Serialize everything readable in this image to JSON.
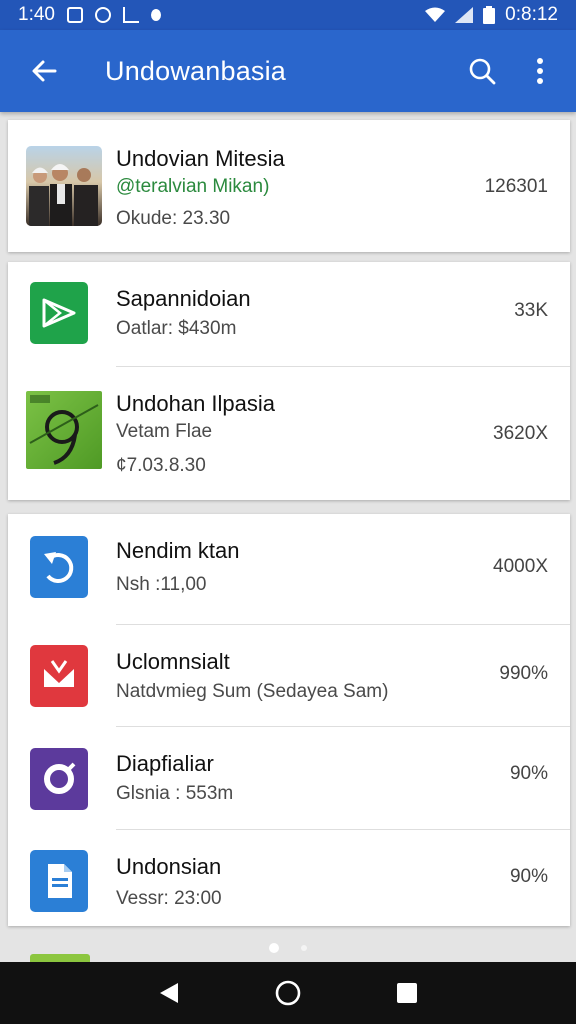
{
  "status_bar": {
    "time_left": "1:40",
    "time_right": "0:8:12",
    "icons": [
      "notification-icon",
      "record-icon",
      "chart-icon",
      "dot-icon",
      "wifi-icon",
      "signal-icon",
      "battery-icon"
    ]
  },
  "app_bar": {
    "title": "Undowanbasia",
    "back_icon": "arrow-left-icon",
    "actions": [
      "search-icon",
      "more-vert-icon"
    ]
  },
  "cards": [
    {
      "items": [
        {
          "title": "Undovian Mitesia",
          "subtitle": "@teralvian Mikan)",
          "meta": "Okude: 23.30",
          "value": "126301",
          "icon": "photo-people-thumb"
        }
      ]
    },
    {
      "items": [
        {
          "title": "Sapannidoian",
          "subtitle": "Oatlar: $430m",
          "value": "33K",
          "icon": "green-send-app-icon",
          "icon_color": "#1fa34a"
        },
        {
          "title": "Undohan Ilpasia",
          "subtitle": "Vetam Flae",
          "meta": "¢7.03.8.30",
          "value": "3620X",
          "icon": "green-map-thumb",
          "icon_color": "#5aa82a"
        }
      ]
    },
    {
      "items": [
        {
          "title": "Nendim ktan",
          "subtitle": "Nsh :11,00",
          "value": "4000X",
          "icon": "blue-refresh-app-icon",
          "icon_color": "#2b7fd6"
        },
        {
          "title": "Uclomnsialt",
          "subtitle": "Natdvmieg Sum (Sedayea Sam)",
          "value": "990%",
          "icon": "red-inbox-app-icon",
          "icon_color": "#e0383e"
        },
        {
          "title": "Diapfialiar",
          "subtitle": "Glsnia : 553m",
          "value": "90%",
          "icon": "purple-ring-app-icon",
          "icon_color": "#5c3a9c"
        },
        {
          "title": "Undonsian",
          "subtitle": "Vessr: 23:00",
          "value": "90%",
          "icon": "blue-document-app-icon",
          "icon_color": "#2b7fd6"
        }
      ]
    }
  ],
  "nav_bar": {
    "buttons": [
      "back-triangle-icon",
      "home-circle-icon",
      "recents-square-icon"
    ]
  },
  "colors": {
    "status_bar": "#2356b8",
    "app_bar": "#2a66cc",
    "background": "#e4e4e4",
    "nav_bar": "#111111"
  }
}
